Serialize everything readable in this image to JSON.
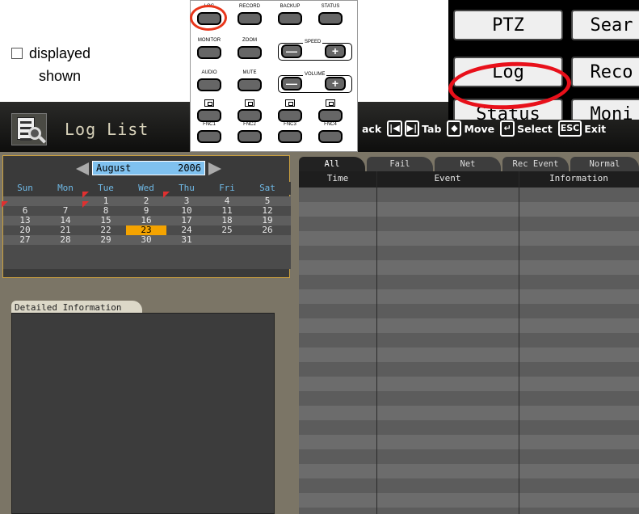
{
  "note": {
    "line1": "displayed",
    "line2": "shown"
  },
  "window": {
    "title": "Log List"
  },
  "hints": [
    {
      "key": "",
      "label": "ack"
    },
    {
      "key": "|◀",
      "label": ""
    },
    {
      "key": "▶|",
      "label": "Tab"
    },
    {
      "key": "◆",
      "label": "Move"
    },
    {
      "key": "↵",
      "label": "Select"
    },
    {
      "key": "ESC",
      "label": "Exit"
    }
  ],
  "calendar": {
    "month": "August",
    "year": "2006",
    "weekdays": [
      "Sun",
      "Mon",
      "Tue",
      "Wed",
      "Thu",
      "Fri",
      "Sat"
    ],
    "weeks": [
      [
        "",
        "",
        "1",
        "2",
        "3",
        "4",
        "5"
      ],
      [
        "6",
        "7",
        "8",
        "9",
        "10",
        "11",
        "12"
      ],
      [
        "13",
        "14",
        "15",
        "16",
        "17",
        "18",
        "19"
      ],
      [
        "20",
        "21",
        "22",
        "23",
        "24",
        "25",
        "26"
      ],
      [
        "27",
        "28",
        "29",
        "30",
        "31",
        "",
        ""
      ]
    ],
    "selected_day": "23",
    "flagged_days": [
      "1",
      "3",
      "6",
      "8"
    ]
  },
  "detail": {
    "tab_label": "Detailed Information"
  },
  "log": {
    "tabs": [
      "All",
      "Fail",
      "Net",
      "Rec Event",
      "Normal"
    ],
    "active_tab": "All",
    "columns": [
      "Time",
      "Event",
      "Information"
    ]
  },
  "remote": {
    "buttons_row1": [
      "LOG",
      "RECORD",
      "BACKUP",
      "STATUS"
    ],
    "buttons_row2": [
      "MONITOR",
      "ZOOM"
    ],
    "speed_label": "SPEED",
    "buttons_row3": [
      "AUDIO",
      "MUTE"
    ],
    "volume_label": "VOLUME",
    "buttons_fnc": [
      "FNC1",
      "FNC2",
      "FNC3",
      "FNC4"
    ],
    "minus": "—",
    "plus": "+"
  },
  "menu_zoom": {
    "items": [
      "PTZ",
      "Sear",
      "Log",
      "Reco",
      "Status",
      "Moni"
    ]
  },
  "colors": {
    "highlight_circle": "#e8101a",
    "selected_day": "#f4a300",
    "month_box": "#7fc1ef"
  }
}
